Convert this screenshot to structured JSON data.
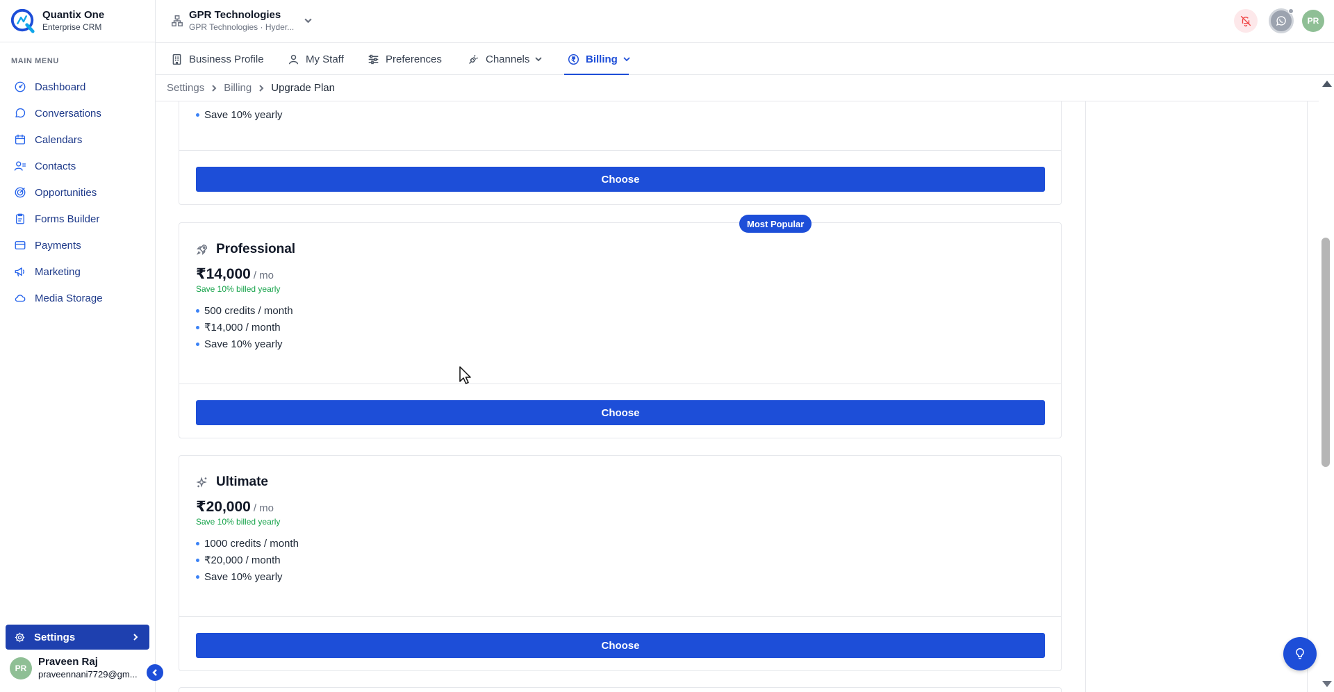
{
  "brand": {
    "name": "Quantix One",
    "subtitle": "Enterprise CRM"
  },
  "org": {
    "name": "GPR Technologies",
    "subtitle": "GPR Technologies · Hyder..."
  },
  "sidebar": {
    "heading": "MAIN MENU",
    "items": [
      {
        "label": "Dashboard",
        "icon": "dashboard-icon"
      },
      {
        "label": "Conversations",
        "icon": "chat-icon"
      },
      {
        "label": "Calendars",
        "icon": "calendar-icon"
      },
      {
        "label": "Contacts",
        "icon": "contacts-icon"
      },
      {
        "label": "Opportunities",
        "icon": "target-icon"
      },
      {
        "label": "Forms Builder",
        "icon": "clipboard-icon"
      },
      {
        "label": "Payments",
        "icon": "card-icon"
      },
      {
        "label": "Marketing",
        "icon": "megaphone-icon"
      },
      {
        "label": "Media Storage",
        "icon": "cloud-icon"
      }
    ],
    "settings_label": "Settings"
  },
  "user": {
    "initials": "PR",
    "name": "Praveen Raj",
    "email": "praveennani7729@gm..."
  },
  "header": {
    "avatar_initials": "PR"
  },
  "tabs": [
    {
      "label": "Business Profile",
      "icon": "building-icon"
    },
    {
      "label": "My Staff",
      "icon": "user-icon"
    },
    {
      "label": "Preferences",
      "icon": "sliders-icon"
    },
    {
      "label": "Channels",
      "icon": "plug-icon"
    },
    {
      "label": "Billing",
      "icon": "rupee-icon",
      "active": true
    }
  ],
  "breadcrumb": [
    "Settings",
    "Billing",
    "Upgrade Plan"
  ],
  "plans": {
    "previous": {
      "features": [
        "Save 10% yearly"
      ],
      "choose_label": "Choose"
    },
    "professional": {
      "badge": "Most Popular",
      "name": "Professional",
      "price": "₹14,000",
      "per": "/ mo",
      "save_note": "Save 10% billed yearly",
      "features": [
        "500 credits / month",
        "₹14,000 / month",
        "Save 10% yearly"
      ],
      "choose_label": "Choose"
    },
    "ultimate": {
      "name": "Ultimate",
      "price": "₹20,000",
      "per": "/ mo",
      "save_note": "Save 10% billed yearly",
      "features": [
        "1000 credits / month",
        "₹20,000 / month",
        "Save 10% yearly"
      ],
      "choose_label": "Choose"
    }
  },
  "colors": {
    "primary": "#1d4ed8",
    "sidebar_text": "#1e3a8a",
    "success": "#16a34a",
    "avatar": "#8fbf95",
    "alert": "#ef4444"
  }
}
